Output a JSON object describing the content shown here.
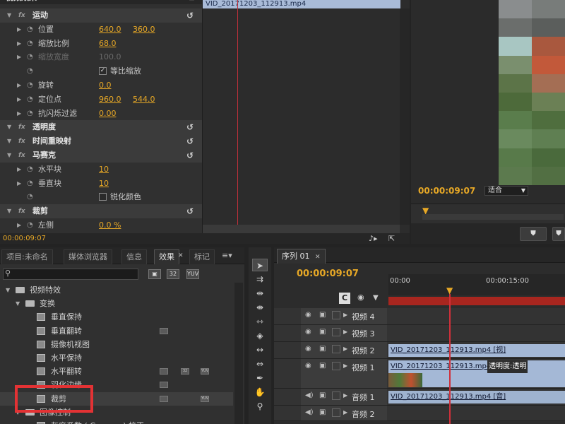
{
  "effect_controls": {
    "title": "视频效果",
    "clip_name": "VID_20171203_112913.mp4",
    "timecode": "00:00:09:07",
    "rows": [
      {
        "label": "运动",
        "kind": "section"
      },
      {
        "label": "位置",
        "v1": "640.0",
        "v2": "360.0"
      },
      {
        "label": "缩放比例",
        "v1": "68.0"
      },
      {
        "label": "缩放宽度",
        "v1": "100.0",
        "dim": true
      },
      {
        "label": "等比缩放",
        "kind": "checkbox",
        "checked": true
      },
      {
        "label": "旋转",
        "v1": "0.0"
      },
      {
        "label": "定位点",
        "v1": "960.0",
        "v2": "544.0"
      },
      {
        "label": "抗闪烁过滤",
        "v1": "0.00"
      },
      {
        "label": "透明度",
        "kind": "section"
      },
      {
        "label": "时间重映射",
        "kind": "section"
      },
      {
        "label": "马赛克",
        "kind": "section"
      },
      {
        "label": "水平块",
        "v1": "10"
      },
      {
        "label": "垂直块",
        "v1": "10"
      },
      {
        "label": "锐化颜色",
        "kind": "checkbox",
        "checked": false
      },
      {
        "label": "裁剪",
        "kind": "section"
      },
      {
        "label": "左侧",
        "v1": "0.0 %"
      }
    ]
  },
  "program_monitor": {
    "timecode": "00:00:09:07",
    "fit_label": "适合",
    "mosaic_colors": [
      "#8a8d8e",
      "#787c7a",
      "#6b6e6c",
      "#5b5e5c",
      "#a8c6c2",
      "#a9583e",
      "#7a8f6e",
      "#c2593a",
      "#5c7448",
      "#a46e54",
      "#4d6a3a",
      "#6b8055",
      "#5a7d4c",
      "#4f6e3e",
      "#6a8a5e",
      "#5f7f52",
      "#587a4a",
      "#4a6a3c",
      "#5c7a4e",
      "#526f43"
    ]
  },
  "project_panel": {
    "tabs": [
      "项目:未命名",
      "媒体浏览器",
      "信息",
      "效果",
      "标记"
    ],
    "active_tab": 3,
    "type_badges": [
      "32",
      "YUV"
    ],
    "tree": [
      {
        "label": "视频特效",
        "level": 0,
        "kind": "folder",
        "open": true
      },
      {
        "label": "变换",
        "level": 1,
        "kind": "folder",
        "open": true
      },
      {
        "label": "垂直保持",
        "level": 2,
        "kind": "effect",
        "badges": []
      },
      {
        "label": "垂直翻转",
        "level": 2,
        "kind": "effect",
        "badges": [
          "a"
        ]
      },
      {
        "label": "摄像机视图",
        "level": 2,
        "kind": "effect",
        "badges": []
      },
      {
        "label": "水平保持",
        "level": 2,
        "kind": "effect",
        "badges": []
      },
      {
        "label": "水平翻转",
        "level": 2,
        "kind": "effect",
        "badges": [
          "a",
          "32",
          "YUV"
        ]
      },
      {
        "label": "羽化边缘",
        "level": 2,
        "kind": "effect",
        "badges": [
          "a"
        ]
      },
      {
        "label": "裁剪",
        "level": 2,
        "kind": "effect",
        "badges": [
          "a",
          "YUV"
        ],
        "highlighted": true
      },
      {
        "label": "图像控制",
        "level": 1,
        "kind": "folder",
        "open": true
      },
      {
        "label": "灰度系数 ( Gamma ) 校正",
        "level": 2,
        "kind": "effect",
        "badges": []
      }
    ]
  },
  "sequence": {
    "tab": "序列 01",
    "timecode": "00:00:09:07",
    "ruler_labels": [
      "00:00",
      "00:00:15:00"
    ],
    "tracks": [
      {
        "name": "视频 4"
      },
      {
        "name": "视频 3"
      },
      {
        "name": "视频 2",
        "clip": "VID_20171203_112913.mp4 [视]"
      },
      {
        "name": "视频 1",
        "clip": "VID_20171203_112913.mp4",
        "clip_extra": "透明度:透明"
      },
      {
        "name": "音频 1",
        "clip": "VID_20171203_112913.mp4 [音]"
      },
      {
        "name": "音频 2"
      }
    ]
  }
}
